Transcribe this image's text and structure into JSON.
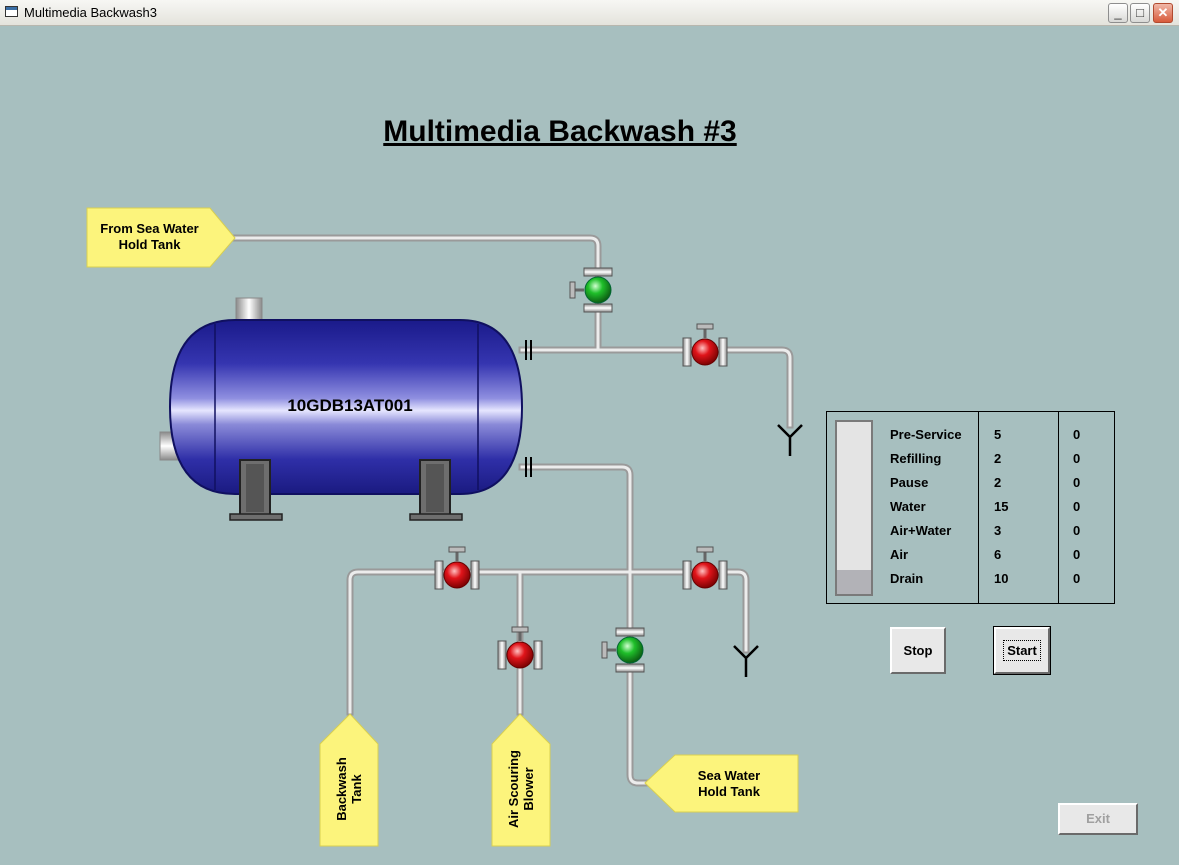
{
  "window": {
    "title": "Multimedia Backwash3"
  },
  "screen": {
    "title": "Multimedia Backwash #3"
  },
  "vessel": {
    "tag": "10GDB13AT001"
  },
  "sources": {
    "sea_water_hold_in": "From Sea Water\nHold Tank",
    "sea_water_hold_out": "Sea  Water\nHold Tank",
    "backwash_tank": "Backwash\nTank",
    "air_blower": "Air Scouring\nBlower"
  },
  "sequence": {
    "progress_fraction": 0.14,
    "steps": [
      {
        "name": "Pre-Service",
        "setpoint": "5",
        "elapsed": "0"
      },
      {
        "name": "Refilling",
        "setpoint": "2",
        "elapsed": "0"
      },
      {
        "name": "Pause",
        "setpoint": "2",
        "elapsed": "0"
      },
      {
        "name": "Water",
        "setpoint": "15",
        "elapsed": "0"
      },
      {
        "name": "Air+Water",
        "setpoint": "3",
        "elapsed": "0"
      },
      {
        "name": "Air",
        "setpoint": "6",
        "elapsed": "0"
      },
      {
        "name": "Drain",
        "setpoint": "10",
        "elapsed": "0"
      }
    ]
  },
  "buttons": {
    "stop": "Stop",
    "start": "Start",
    "exit": "Exit"
  },
  "valves": {
    "inlet_valve": "open",
    "top_drain_valve": "closed",
    "backwash_valve": "closed",
    "bottom_drain_valve": "closed",
    "air_valve": "closed",
    "outlet_valve": "open"
  },
  "colors": {
    "valve_open": "#1fbf2a",
    "valve_closed": "#e0141a",
    "label_fill": "#fcf47c",
    "vessel": "#2a2a9a"
  }
}
